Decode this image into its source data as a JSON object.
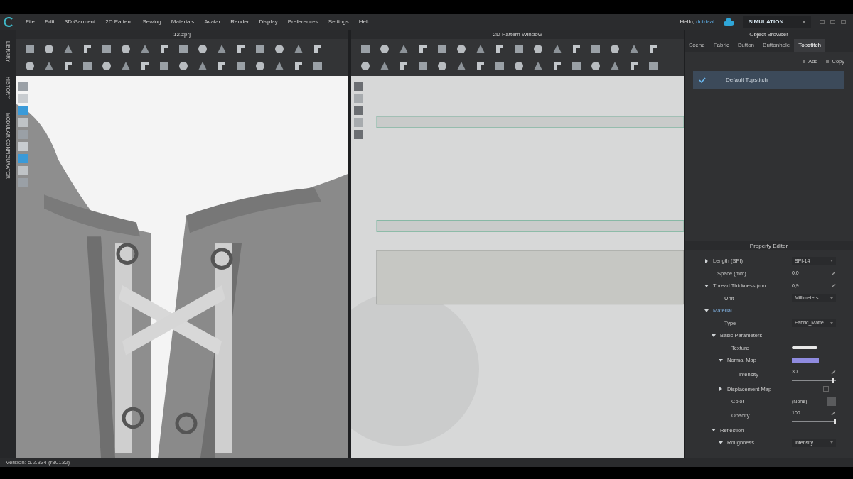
{
  "menu": [
    "File",
    "Edit",
    "3D Garment",
    "2D Pattern",
    "Sewing",
    "Materials",
    "Avatar",
    "Render",
    "Display",
    "Preferences",
    "Settings",
    "Help"
  ],
  "user": {
    "greeting": "Hello,",
    "name": "dctriaal"
  },
  "mode": {
    "label": "SIMULATION"
  },
  "side_tabs": [
    "LIBRARY",
    "HISTORY",
    "MODULAR CONFIGURATOR"
  ],
  "window_3d": {
    "title": "12.zprj"
  },
  "window_2d": {
    "title": "2D Pattern Window"
  },
  "object_browser": {
    "title": "Object Browser",
    "tabs": [
      {
        "label": "Scene",
        "selected": false
      },
      {
        "label": "Fabric",
        "selected": false
      },
      {
        "label": "Button",
        "selected": false
      },
      {
        "label": "Buttonhole",
        "selected": false
      },
      {
        "label": "Topstitch",
        "selected": true
      }
    ],
    "actions": [
      "Add",
      "Copy"
    ],
    "items": [
      {
        "label": "Default Topstitch",
        "selected": true
      }
    ]
  },
  "property_editor": {
    "title": "Property Editor",
    "rows": [
      {
        "label": "Length (SPI)",
        "kind": "dropdown",
        "value": "SPI-14",
        "expanded": false
      },
      {
        "label": "Space (mm)",
        "kind": "value",
        "value": "0,0"
      },
      {
        "label": "Thread Thickness (mn",
        "kind": "value",
        "value": "0,9",
        "expanded": true,
        "children": [
          {
            "label": "Unit",
            "kind": "dropdown",
            "value": "Millimeters"
          }
        ]
      },
      {
        "label": "Material",
        "kind": "section",
        "expanded": true,
        "children": [
          {
            "label": "Type",
            "kind": "dropdown",
            "value": "Fabric_Matte"
          },
          {
            "label": "Basic Parameters",
            "kind": "group",
            "expanded": true,
            "children": [
              {
                "label": "Texture",
                "kind": "texture"
              },
              {
                "label": "Normal Map",
                "kind": "map",
                "expanded": true,
                "children": [
                  {
                    "label": "Intensity",
                    "kind": "slider",
                    "value": "30",
                    "level": 0.95
                  }
                ]
              },
              {
                "label": "Displacement Map",
                "kind": "map_empty",
                "expanded": false
              },
              {
                "label": "Color",
                "kind": "color",
                "value": "(None)"
              },
              {
                "label": "Opacity",
                "kind": "slider",
                "value": "100",
                "level": 1
              }
            ]
          },
          {
            "label": "Reflection",
            "kind": "group",
            "expanded": true,
            "children": [
              {
                "label": "Roughness",
                "kind": "dropdown",
                "value": "Intensity",
                "expanded": true
              }
            ]
          }
        ]
      }
    ]
  },
  "status_bar": {
    "version": "Version: 5.2.334 (r30132)"
  }
}
